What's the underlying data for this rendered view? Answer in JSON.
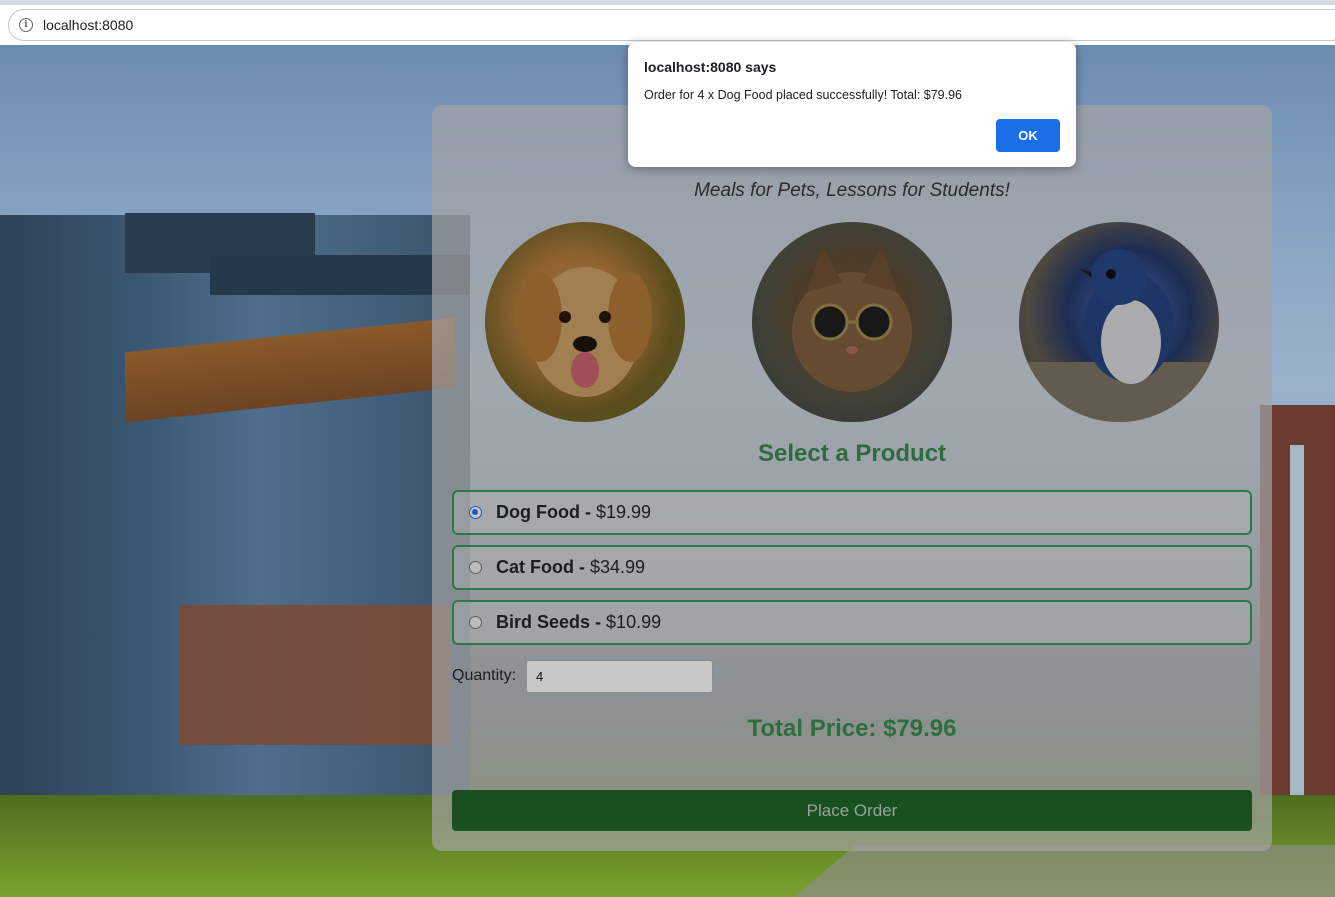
{
  "browser": {
    "url": "localhost:8080"
  },
  "card": {
    "tagline": "Meals for Pets, Lessons for Students!",
    "section_title": "Select a Product",
    "options": [
      {
        "name": "Dog Food",
        "separator": "-",
        "price": "$19.99",
        "selected": true
      },
      {
        "name": "Cat Food",
        "separator": "-",
        "price": "$34.99",
        "selected": false
      },
      {
        "name": "Bird Seeds",
        "separator": "-",
        "price": "$10.99",
        "selected": false
      }
    ],
    "quantity_label": "Quantity:",
    "quantity_value": "4",
    "total_price": "Total Price: $79.96",
    "place_order_label": "Place Order"
  },
  "dialog": {
    "title": "localhost:8080 says",
    "message": "Order for 4 x Dog Food placed successfully! Total: $79.96",
    "ok_label": "OK"
  },
  "colors": {
    "accent_green": "#2f6b3f",
    "button_green": "#18501f",
    "ok_blue": "#1a6fe8"
  }
}
